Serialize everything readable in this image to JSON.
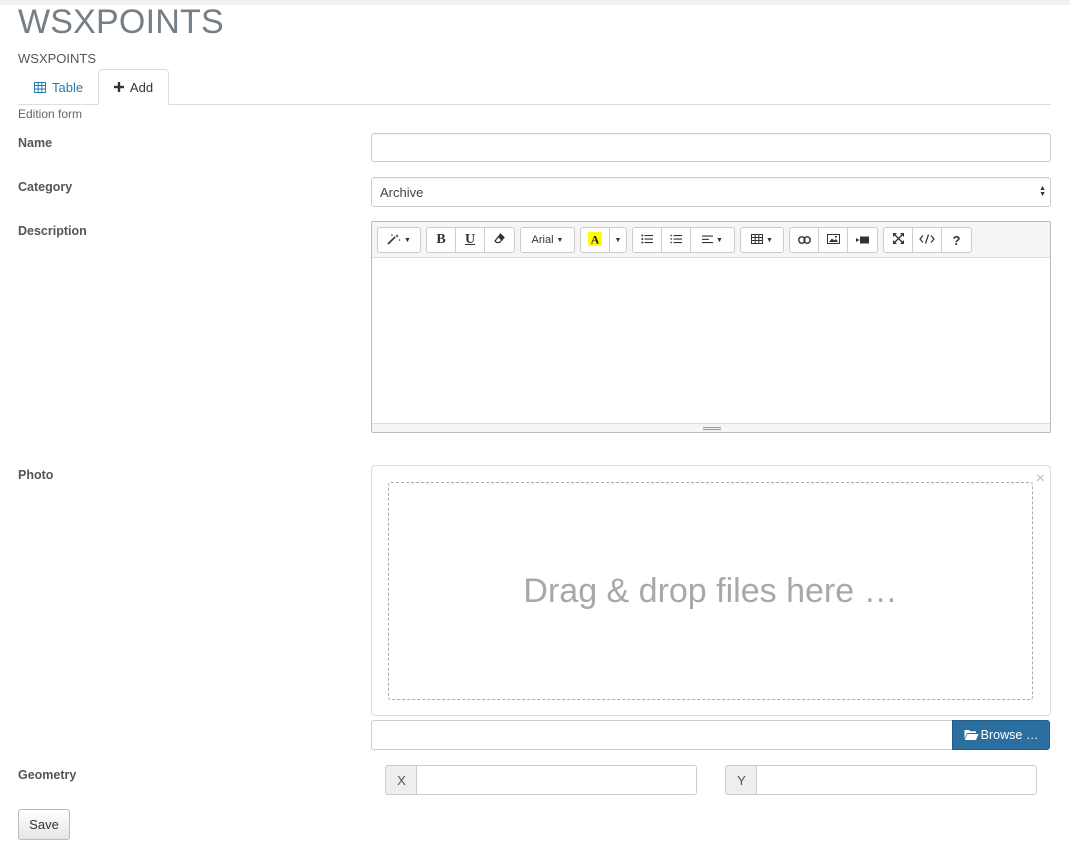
{
  "page": {
    "title": "WSXPOINTS",
    "subtitle": "WSXPOINTS"
  },
  "tabs": [
    {
      "label": "Table",
      "icon": "table-icon"
    },
    {
      "label": "Add",
      "icon": "plus-icon"
    }
  ],
  "form": {
    "caption": "Edition form",
    "name": {
      "label": "Name",
      "value": ""
    },
    "category": {
      "label": "Category",
      "selected": "Archive"
    },
    "description": {
      "label": "Description",
      "toolbar": {
        "font_name": "Arial",
        "bold": "B",
        "underline": "U",
        "help": "?"
      },
      "content": ""
    },
    "photo": {
      "label": "Photo",
      "drop_text": "Drag & drop files here …",
      "close_symbol": "×",
      "file_caption": "",
      "browse_label": "Browse …"
    },
    "geometry": {
      "label": "Geometry",
      "x_label": "X",
      "x_value": "",
      "y_label": "Y",
      "y_value": ""
    },
    "save_label": "Save"
  },
  "colors": {
    "link": "#2a7ab0",
    "primary_button": "#2a6f9f",
    "highlight_swatch": "#ffff00"
  }
}
